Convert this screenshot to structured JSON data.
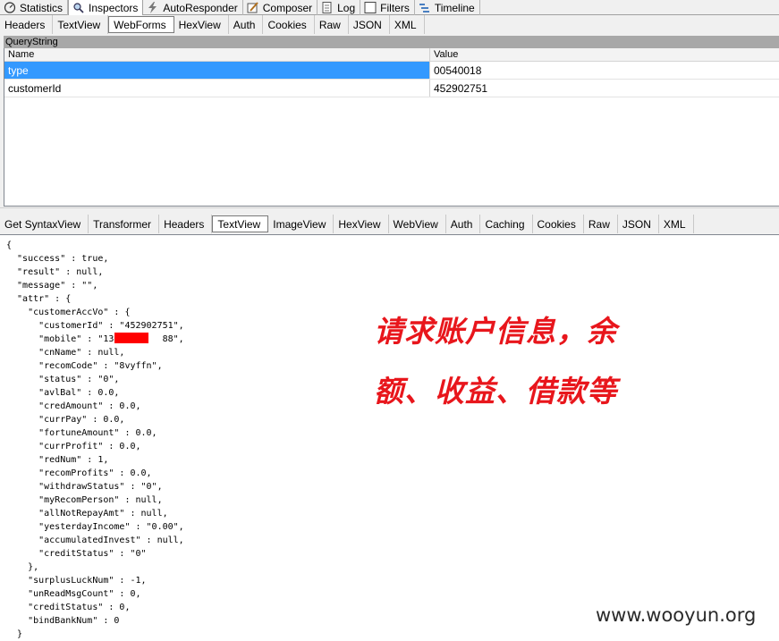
{
  "main_tabs": [
    "Statistics",
    "Inspectors",
    "AutoResponder",
    "Composer",
    "Log",
    "Filters",
    "Timeline"
  ],
  "request_tabs": [
    "Headers",
    "TextView",
    "WebForms",
    "HexView",
    "Auth",
    "Cookies",
    "Raw",
    "JSON",
    "XML"
  ],
  "querystring": {
    "title": "QueryString",
    "col_name": "Name",
    "col_value": "Value",
    "rows": [
      {
        "name": "type",
        "value": "00540018"
      },
      {
        "name": "customerId",
        "value": "452902751"
      }
    ]
  },
  "response_tabs": [
    "Get SyntaxView",
    "Transformer",
    "Headers",
    "TextView",
    "ImageView",
    "HexView",
    "WebView",
    "Auth",
    "Caching",
    "Cookies",
    "Raw",
    "JSON",
    "XML"
  ],
  "json_lines": [
    "{",
    "  \"success\" : true,",
    "  \"result\" : null,",
    "  \"message\" : \"\",",
    "  \"attr\" : {",
    "    \"customerAccVo\" : {",
    "      \"customerId\" : \"452902751\",",
    "      \"mobile\" : \"134        88\",",
    "      \"cnName\" : null,",
    "      \"recomCode\" : \"8vyffn\",",
    "      \"status\" : \"0\",",
    "      \"avlBal\" : 0.0,",
    "      \"credAmount\" : 0.0,",
    "      \"currPay\" : 0.0,",
    "      \"fortuneAmount\" : 0.0,",
    "      \"currProfit\" : 0.0,",
    "      \"redNum\" : 1,",
    "      \"recomProfits\" : 0.0,",
    "      \"withdrawStatus\" : \"0\",",
    "      \"myRecomPerson\" : null,",
    "      \"allNotRepayAmt\" : null,",
    "      \"yesterdayIncome\" : \"0.00\",",
    "      \"accumulatedInvest\" : null,",
    "      \"creditStatus\" : \"0\"",
    "    },",
    "    \"surplusLuckNum\" : -1,",
    "    \"unReadMsgCount\" : 0,",
    "    \"creditStatus\" : 0,",
    "    \"bindBankNum\" : 0",
    "  }"
  ],
  "annotation_line1": "请求账户信息，余",
  "annotation_line2": "额、收益、借款等",
  "watermark": "www.wooyun.org"
}
